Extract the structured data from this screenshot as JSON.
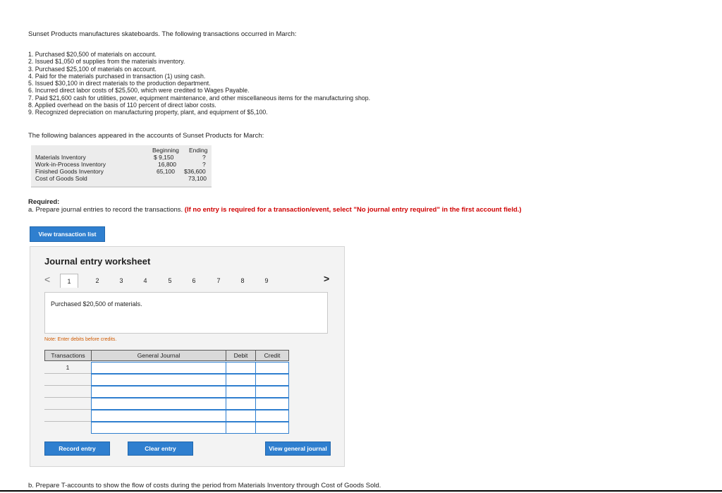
{
  "intro": "Sunset Products manufactures skateboards. The following transactions occurred in March:",
  "transactions": [
    "1. Purchased $20,500 of materials on account.",
    "2. Issued $1,050 of supplies from the materials inventory.",
    "3. Purchased $25,100 of materials on account.",
    "4. Paid for the materials purchased in transaction (1) using cash.",
    "5. Issued $30,100 in direct materials to the production department.",
    "6. Incurred direct labor costs of $25,500, which were credited to Wages Payable.",
    "7. Paid $21,600 cash for utilities, power, equipment maintenance, and other miscellaneous items for the manufacturing shop.",
    "8. Applied overhead on the basis of 110 percent of direct labor costs.",
    "9. Recognized depreciation on manufacturing property, plant, and equipment of $5,100."
  ],
  "balances_intro": "The following balances appeared in the accounts of Sunset Products for March:",
  "balances": {
    "col_beginning": "Beginning",
    "col_ending": "Ending",
    "rows": [
      {
        "account": "Materials Inventory",
        "beginning": "$ 9,150",
        "ending": "?"
      },
      {
        "account": "Work-in-Process Inventory",
        "beginning": "16,800",
        "ending": "?"
      },
      {
        "account": "Finished Goods Inventory",
        "beginning": "65,100",
        "ending": "$36,600"
      },
      {
        "account": "Cost of Goods Sold",
        "beginning": "",
        "ending": "73,100"
      }
    ]
  },
  "required": {
    "label": "Required:",
    "a_prefix": "a. Prepare journal entries to record the transactions. ",
    "a_note": "(If no entry is required for a transaction/event, select \"No journal entry required\" in the first account field.)",
    "b": "b. Prepare T-accounts to show the flow of costs during the period from Materials Inventory through Cost of Goods Sold."
  },
  "buttons": {
    "view_transaction_list": "View transaction list",
    "record_entry": "Record entry",
    "clear_entry": "Clear entry",
    "view_general_journal": "View general journal"
  },
  "worksheet": {
    "title": "Journal entry worksheet",
    "nav_prev": "<",
    "nav_next": ">",
    "tabs": [
      "1",
      "2",
      "3",
      "4",
      "5",
      "6",
      "7",
      "8",
      "9"
    ],
    "active_tab": "1",
    "description": "Purchased $20,500 of materials.",
    "note": "Note: Enter debits before credits.",
    "table": {
      "headers": {
        "transactions": "Transactions",
        "general_journal": "General Journal",
        "debit": "Debit",
        "credit": "Credit"
      },
      "first_row_transaction": "1"
    }
  }
}
